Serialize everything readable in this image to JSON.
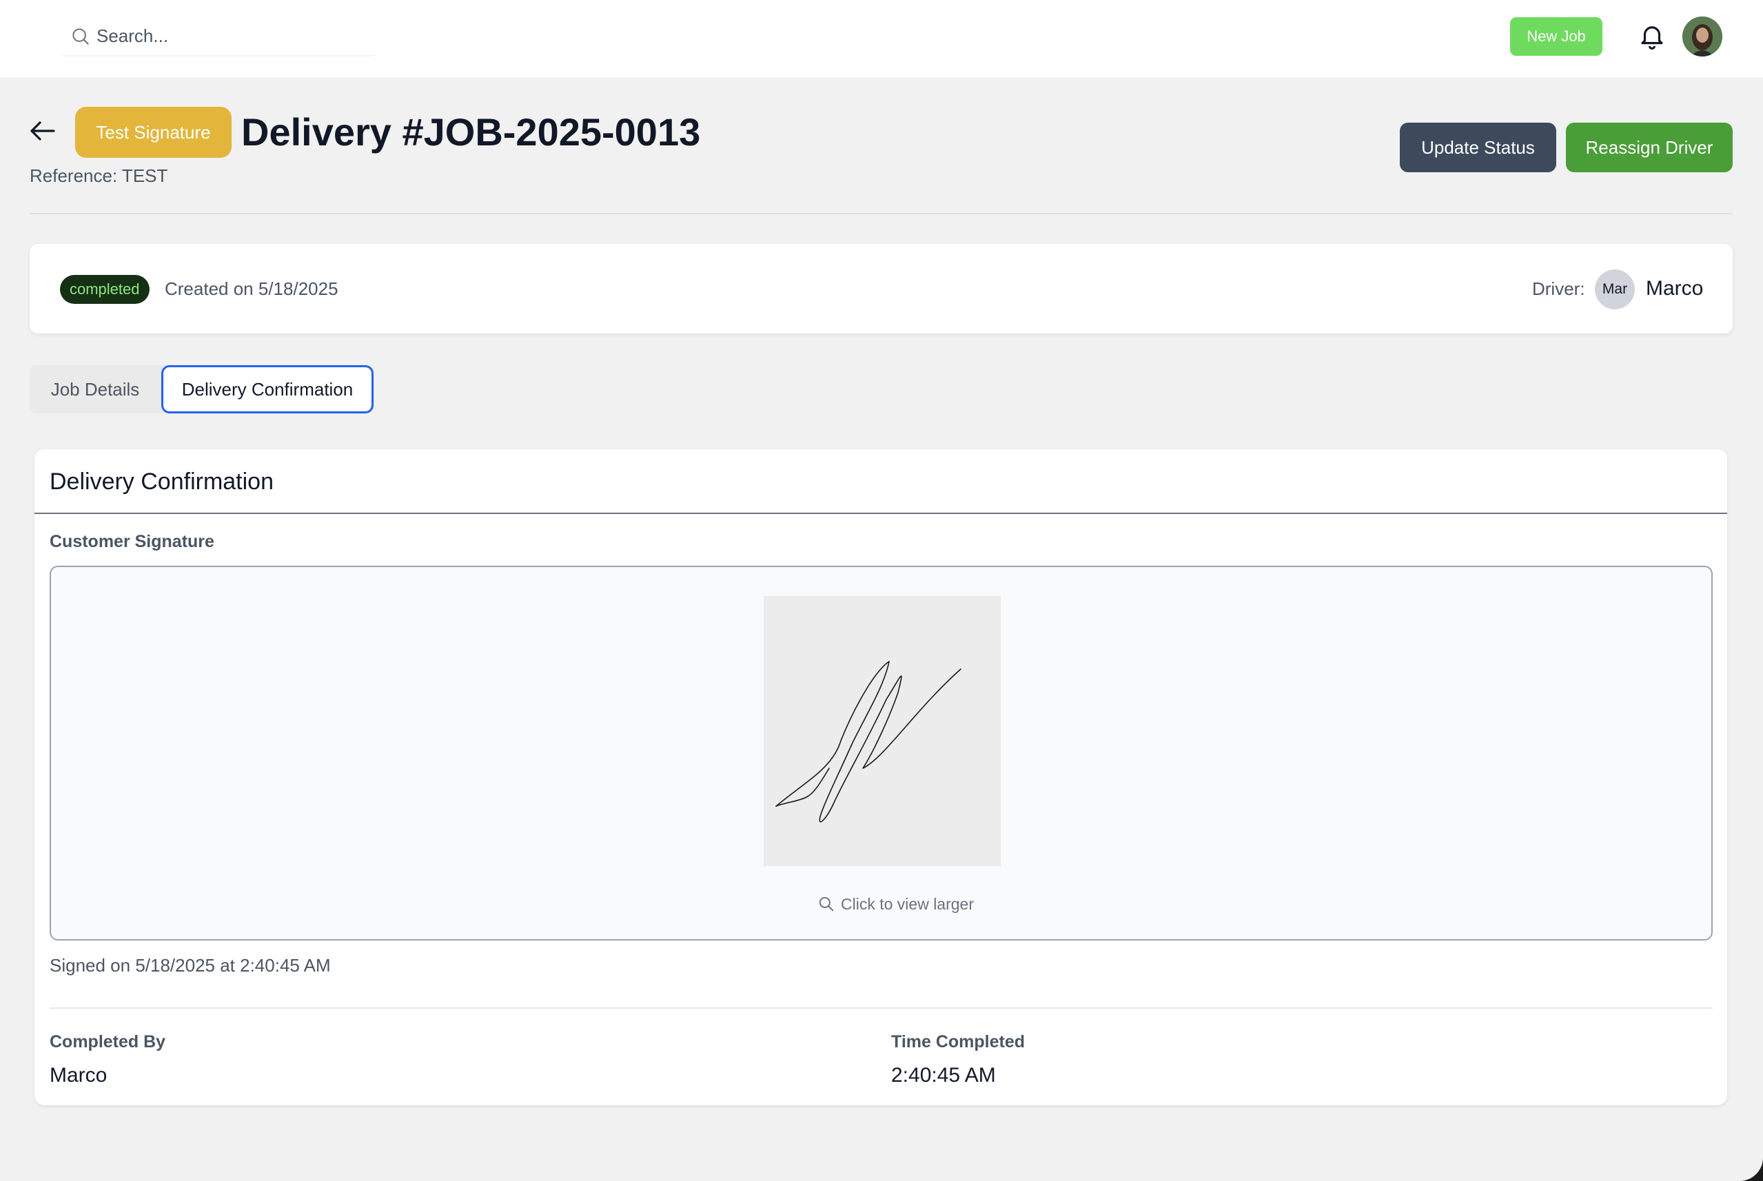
{
  "header": {
    "search_placeholder": "Search...",
    "new_job_label": "New Job"
  },
  "job": {
    "tag": "Test Signature",
    "title": "Delivery #JOB-2025-0013",
    "reference": "Reference: TEST",
    "update_status_label": "Update Status",
    "reassign_driver_label": "Reassign Driver"
  },
  "status": {
    "badge": "completed",
    "created": "Created on 5/18/2025",
    "driver_label": "Driver:",
    "driver_initials": "Mar",
    "driver_name": "Marco"
  },
  "tabs": [
    {
      "label": "Job Details",
      "active": false
    },
    {
      "label": "Delivery Confirmation",
      "active": true
    }
  ],
  "confirmation": {
    "title": "Delivery Confirmation",
    "signature_label": "Customer Signature",
    "view_larger": "Click to view larger",
    "signed_on": "Signed on 5/18/2025 at 2:40:45 AM",
    "completed_by_label": "Completed By",
    "completed_by_value": "Marco",
    "time_completed_label": "Time Completed",
    "time_completed_value": "2:40:45 AM"
  },
  "icons": {
    "search": "search-icon",
    "bell": "bell-icon",
    "back": "arrow-left-icon",
    "magnifier": "magnifier-icon"
  },
  "colors": {
    "new_job": "#6fdb5e",
    "tag": "#e3b53a",
    "update_status": "#3c4a5c",
    "reassign_driver": "#4a9e37",
    "badge_bg": "#163016",
    "badge_text": "#8ee87a",
    "active_tab_border": "#2563eb"
  }
}
